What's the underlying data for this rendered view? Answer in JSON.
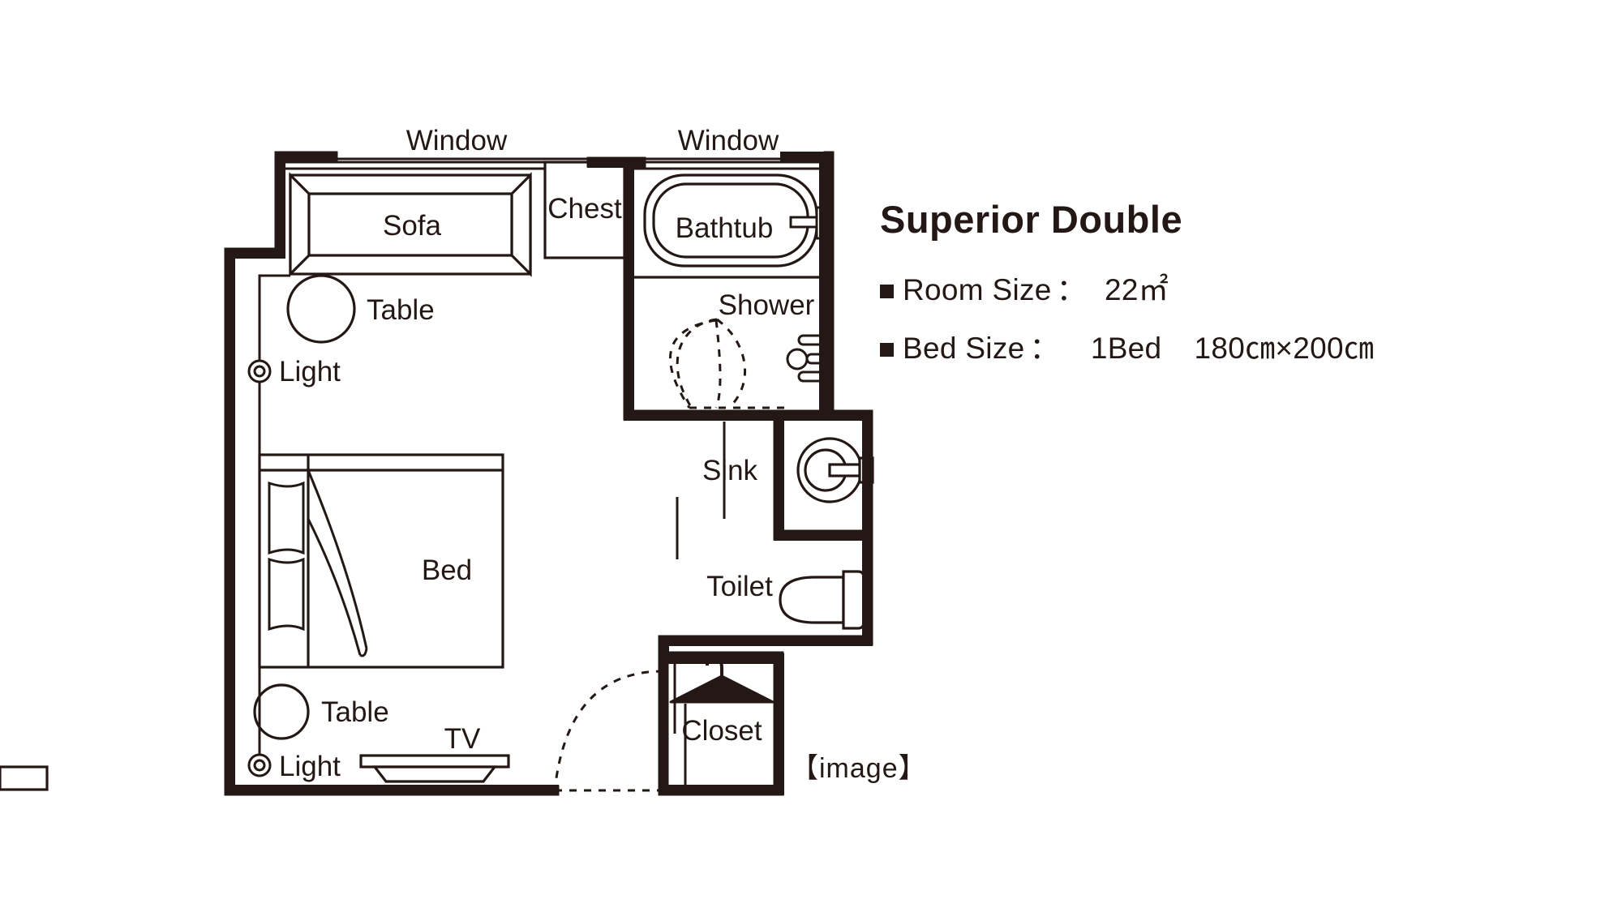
{
  "room": {
    "title": "Superior Double",
    "specs": [
      {
        "label": "Room Size",
        "colon": "：",
        "value": "22㎡"
      },
      {
        "label": "Bed Size",
        "colon": "：",
        "bed_count": "1Bed",
        "bed_dimensions": "180㎝×200㎝"
      }
    ],
    "room_size_number": "22",
    "room_size_unit": "m",
    "room_size_sup": "2",
    "bed_size_value": "1Bed 180cm×200cm",
    "image_note": "【image】"
  },
  "labels": {
    "window_left": "Window",
    "window_right": "Window",
    "sofa": "Sofa",
    "chest": "Chest",
    "bathtub": "Bathtub",
    "table_top": "Table",
    "light_top": "Light",
    "bed": "Bed",
    "shower": "Shower",
    "sink": "Sink",
    "toilet": "Toilet",
    "closet": "Closet",
    "table_bottom": "Table",
    "light_bottom": "Light",
    "tv": "TV"
  },
  "colors": {
    "wall": "#231815",
    "line": "#231815",
    "background": "#ffffff",
    "text": "#231815"
  },
  "plan": {
    "type": "floor-plan",
    "fixtures": [
      "sofa",
      "chest",
      "bathtub",
      "round-table-top",
      "light-top",
      "bed",
      "shower",
      "sink",
      "toilet",
      "closet",
      "round-table-bottom",
      "light-bottom",
      "tv",
      "entry-door",
      "shower-door"
    ]
  }
}
